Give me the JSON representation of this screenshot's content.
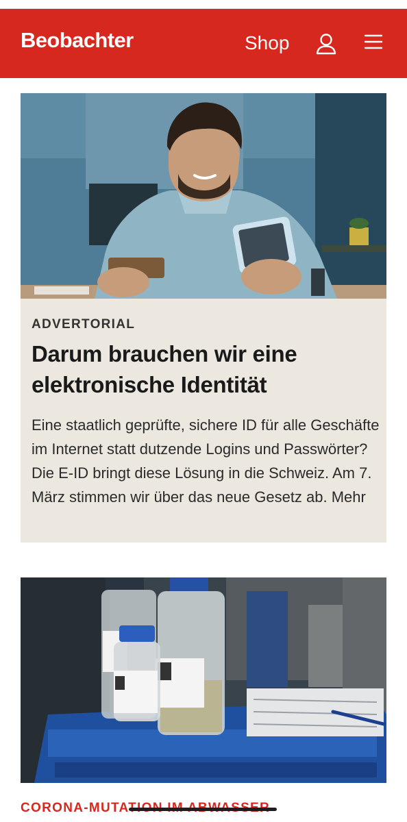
{
  "header": {
    "logo": "Beobachter",
    "shop_label": "Shop",
    "user_icon": "user-icon",
    "menu_icon": "hamburger-menu-icon",
    "brand_color": "#d6281f"
  },
  "article1": {
    "kicker": "ADVERTORIAL",
    "headline": "Darum brauchen wir eine elektronische Identität",
    "teaser": "Eine staatlich geprüfte, sichere ID für alle Geschäfte im Internet statt dutzende Logins und Passwörter? Die E-ID bringt diese Lösung in die Schweiz. Am 7. März stimmen wir über das neue Gesetz ab. Mehr",
    "background_color": "#ece8e0"
  },
  "article2": {
    "kicker": "CORONA-MUTATION IM ABWASSER",
    "kicker_color": "#d6281f"
  }
}
